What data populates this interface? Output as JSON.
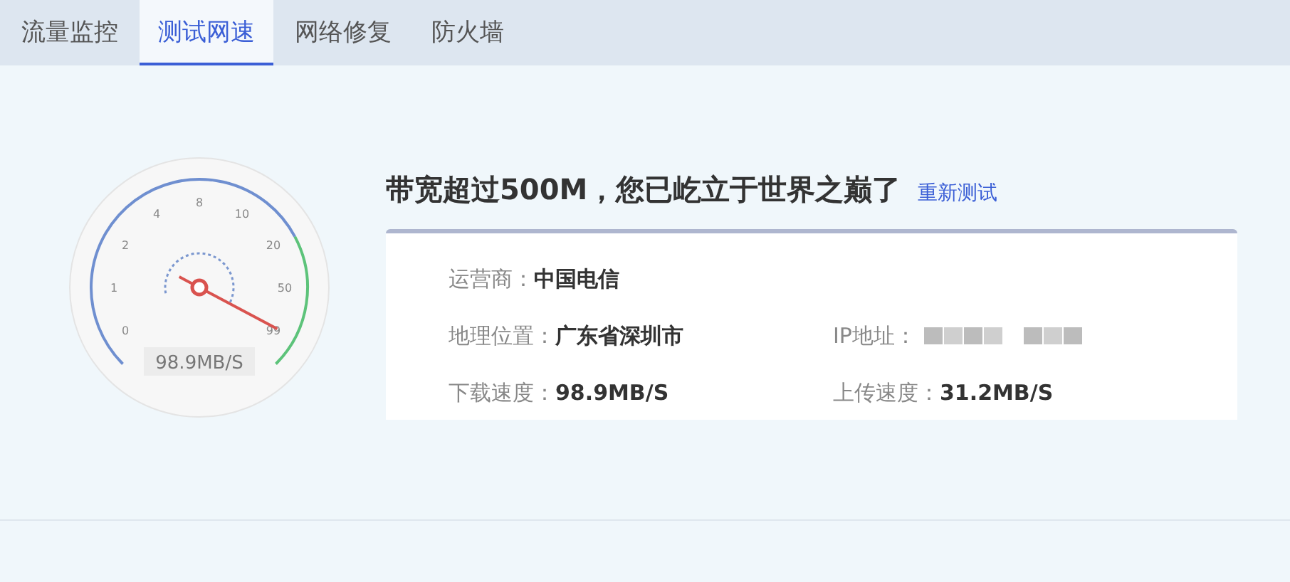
{
  "tabs": [
    {
      "label": "流量监控",
      "selected": false
    },
    {
      "label": "测试网速",
      "selected": true
    },
    {
      "label": "网络修复",
      "selected": false
    },
    {
      "label": "防火墙",
      "selected": false
    }
  ],
  "gauge": {
    "ticks": [
      "0",
      "1",
      "2",
      "4",
      "8",
      "10",
      "20",
      "50",
      "99"
    ],
    "reading": "98.9MB/S"
  },
  "result": {
    "headline": "带宽超过500M，您已屹立于世界之巅了",
    "retest_link": "重新测试"
  },
  "details": [
    {
      "label": "运营商：",
      "value": "中国电信"
    },
    {
      "label": "地理位置：",
      "value": "广东省深圳市"
    },
    {
      "label": "IP地址：",
      "kind": "redacted"
    },
    {
      "label": "下载速度：",
      "value": "98.9MB/S"
    },
    {
      "label": "上传速度：",
      "value": "31.2MB/S"
    }
  ]
}
